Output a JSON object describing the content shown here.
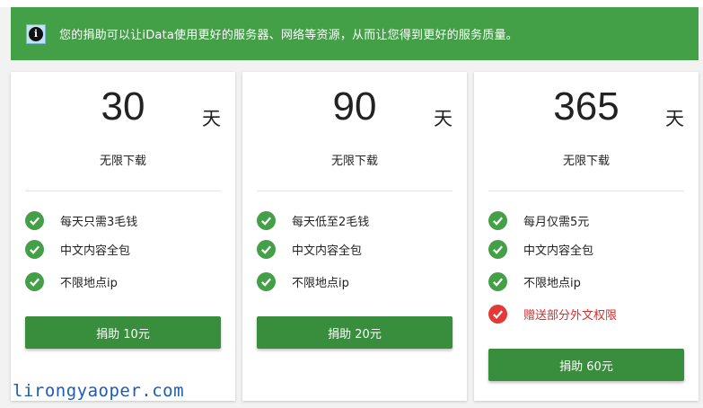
{
  "banner": {
    "text": "您的捐助可以让iData使用更好的服务器、网络等资源，从而让您得到更好的服务质量。",
    "icon": "info-icon"
  },
  "plans": [
    {
      "days": "30",
      "unit": "天",
      "subtitle": "无限下载",
      "features": [
        {
          "text": "每天只需3毛钱",
          "icon": "check-icon"
        },
        {
          "text": "中文内容全包",
          "icon": "check-icon"
        },
        {
          "text": "不限地点ip",
          "icon": "check-icon"
        }
      ],
      "button": "捐助 10元"
    },
    {
      "days": "90",
      "unit": "天",
      "subtitle": "无限下载",
      "features": [
        {
          "text": "每天低至2毛钱",
          "icon": "check-icon"
        },
        {
          "text": "中文内容全包",
          "icon": "check-icon"
        },
        {
          "text": "不限地点ip",
          "icon": "check-icon"
        }
      ],
      "button": "捐助 20元"
    },
    {
      "days": "365",
      "unit": "天",
      "subtitle": "无限下载",
      "features": [
        {
          "text": "每月仅需5元",
          "icon": "check-icon"
        },
        {
          "text": "中文内容全包",
          "icon": "check-icon"
        },
        {
          "text": "不限地点ip",
          "icon": "check-icon"
        },
        {
          "text": "赠送部分外文权限",
          "icon": "check-icon",
          "color": "#e53935"
        }
      ],
      "button": "捐助 60元"
    }
  ],
  "watermark": "lirongyaoper.com",
  "colors": {
    "banner": "#43a047",
    "button": "#388e3c",
    "check": "#43a047",
    "highlight": "#e53935"
  }
}
